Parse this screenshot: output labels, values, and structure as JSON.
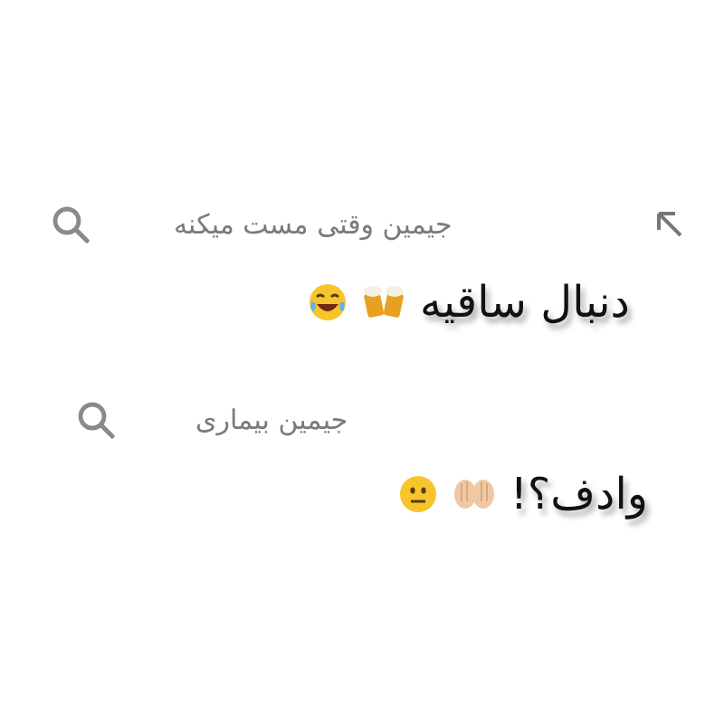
{
  "blocks": [
    {
      "kind": "suggestion",
      "text": "جیمین وقتی مست میکنه",
      "fill_arrow": true
    },
    {
      "kind": "caption",
      "text": "دنبال ساقیه"
    },
    {
      "kind": "suggestion",
      "text": "جیمین بیماری",
      "fill_arrow": false
    },
    {
      "kind": "caption",
      "text": "وادف؟!"
    }
  ]
}
